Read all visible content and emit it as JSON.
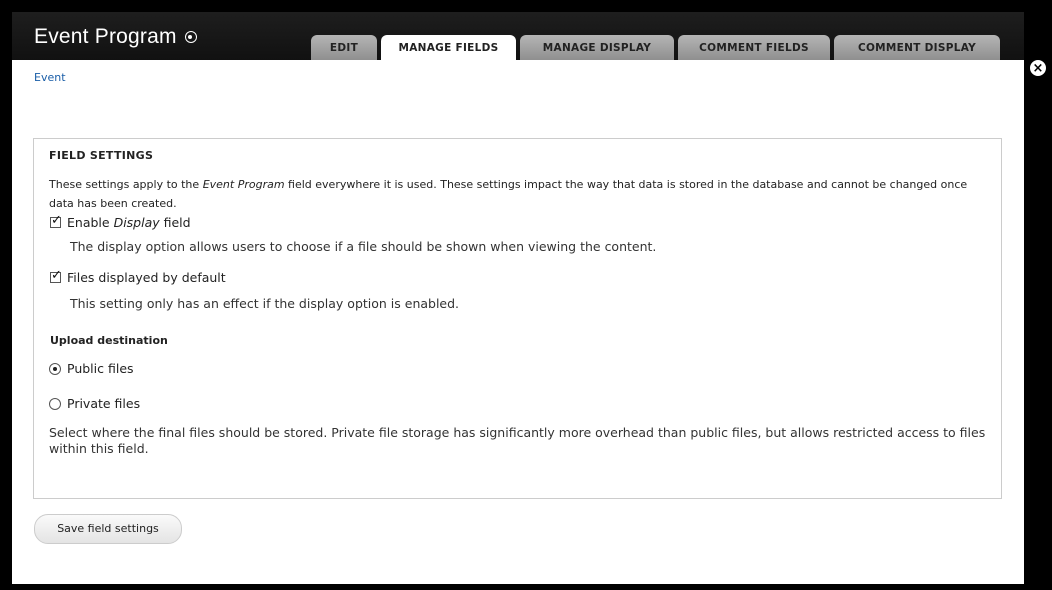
{
  "header": {
    "title": "Event Program",
    "tabs": [
      {
        "label": "EDIT",
        "active": false
      },
      {
        "label": "MANAGE FIELDS",
        "active": true
      },
      {
        "label": "MANAGE DISPLAY",
        "active": false
      },
      {
        "label": "COMMENT FIELDS",
        "active": false
      },
      {
        "label": "COMMENT DISPLAY",
        "active": false
      }
    ]
  },
  "breadcrumb": "Event",
  "close_icon": "×",
  "field_settings": {
    "legend": "FIELD SETTINGS",
    "description_before": "These settings apply to the ",
    "description_em": "Event Program",
    "description_after": " field everywhere it is used. These settings impact the way that data is stored in the database and cannot be changed once data has been created.",
    "display_field": {
      "label_before": "Enable ",
      "label_em": "Display",
      "label_after": " field",
      "checked": true,
      "help": "The display option allows users to choose if a file should be shown when viewing the content."
    },
    "display_default": {
      "label": "Files displayed by default",
      "checked": true,
      "help": "This setting only has an effect if the display option is enabled."
    },
    "upload_destination": {
      "heading": "Upload destination",
      "options": [
        {
          "label": "Public files",
          "selected": true
        },
        {
          "label": "Private files",
          "selected": false
        }
      ],
      "help": "Select where the final files should be stored. Private file storage has significantly more overhead than public files, but allows restricted access to files within this field."
    }
  },
  "save_button": "Save field settings",
  "colors": {
    "background": "#000000",
    "panel": "#ffffff",
    "tab_inactive": "#a8a8a8",
    "link": "#1a5ea8"
  }
}
